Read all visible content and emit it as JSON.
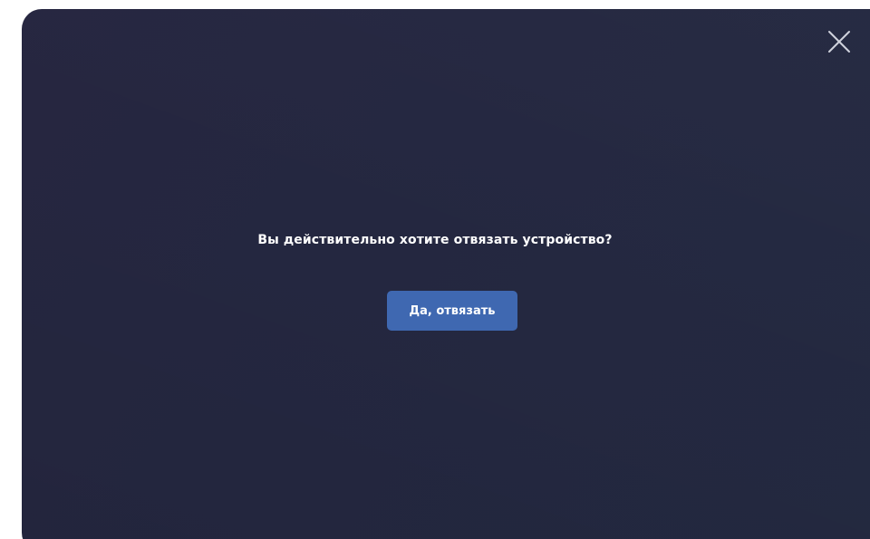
{
  "dialog": {
    "close_icon": "close-icon",
    "message": "Вы действительно хотите отвязать устройство?",
    "confirm_label": "Да, отвязать"
  },
  "colors": {
    "dialog_background": "#24273f",
    "button_background": "#3f68b1",
    "text": "#ffffff"
  }
}
